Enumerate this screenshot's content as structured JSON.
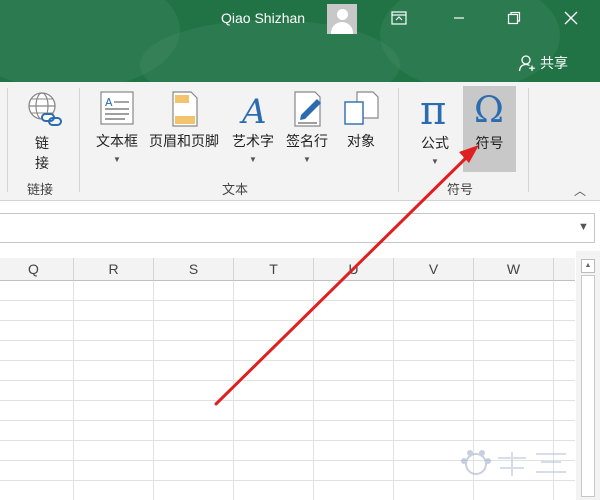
{
  "titlebar": {
    "user_name": "Qiao Shizhan",
    "share_label": "共享",
    "bg_color": "#217346"
  },
  "ribbon": {
    "link": {
      "label_line1": "链",
      "label_line2": "接",
      "group": "链接"
    },
    "text_group": {
      "textbox": "文本框",
      "header_footer": "页眉和页脚",
      "wordart": "艺术字",
      "signature": "签名行",
      "object": "对象",
      "group": "文本"
    },
    "symbols_group": {
      "equation": "公式",
      "symbol": "符号",
      "group": "符号"
    }
  },
  "grid": {
    "columns": [
      "Q",
      "R",
      "S",
      "T",
      "U",
      "V",
      "W"
    ]
  },
  "annotation": {
    "arrow_color": "#e02020"
  }
}
